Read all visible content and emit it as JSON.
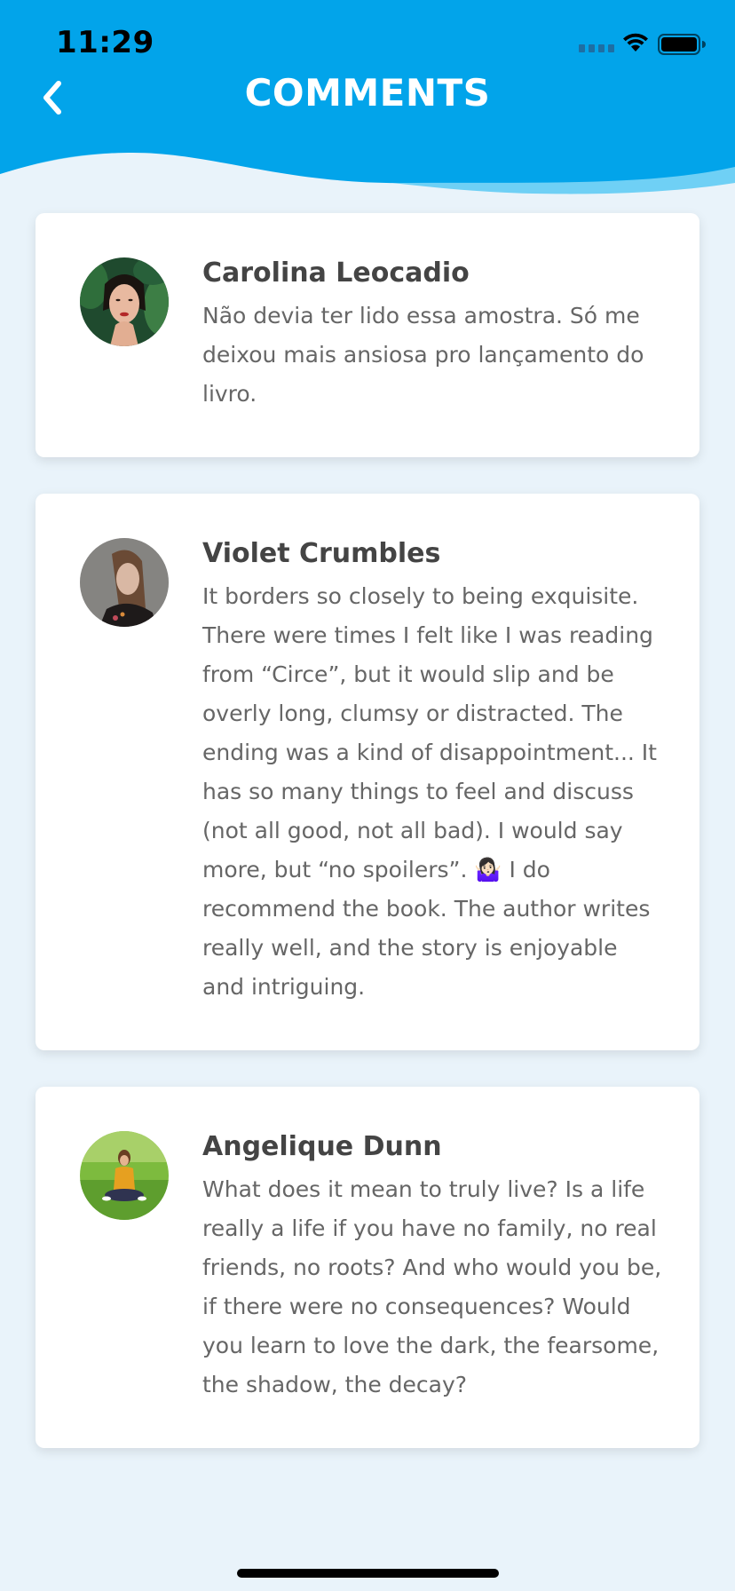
{
  "status_bar": {
    "time": "11:29"
  },
  "header": {
    "title": "COMMENTS"
  },
  "colors": {
    "header_blue": "#02A4EA",
    "header_wave_light": "#6FD0F5",
    "page_background": "#E9F3FA",
    "card_background": "#FFFFFF"
  },
  "comments": [
    {
      "author": "Carolina Leocadio",
      "text": "Não devia ter lido essa amostra. Só me deixou mais ansiosa pro lançamento do livro."
    },
    {
      "author": "Violet Crumbles",
      "text": "It borders so closely to being exquisite. There were times I felt like I was reading from “Circe”, but it would slip and be overly long, clumsy or distracted. The ending was a kind of disappointment... It has so many things to feel and discuss (not all good, not all bad). I would say more, but “no spoilers”. 🤷🏻‍♀️ I do recommend the book. The author writes really well, and the story is enjoyable and intriguing."
    },
    {
      "author": "Angelique Dunn",
      "text": "What does it mean to truly live? Is a life really a life if you have no family, no real friends, no roots? And who would you be, if there were no consequences? Would you learn to love the dark, the fearsome, the shadow, the decay?"
    }
  ]
}
